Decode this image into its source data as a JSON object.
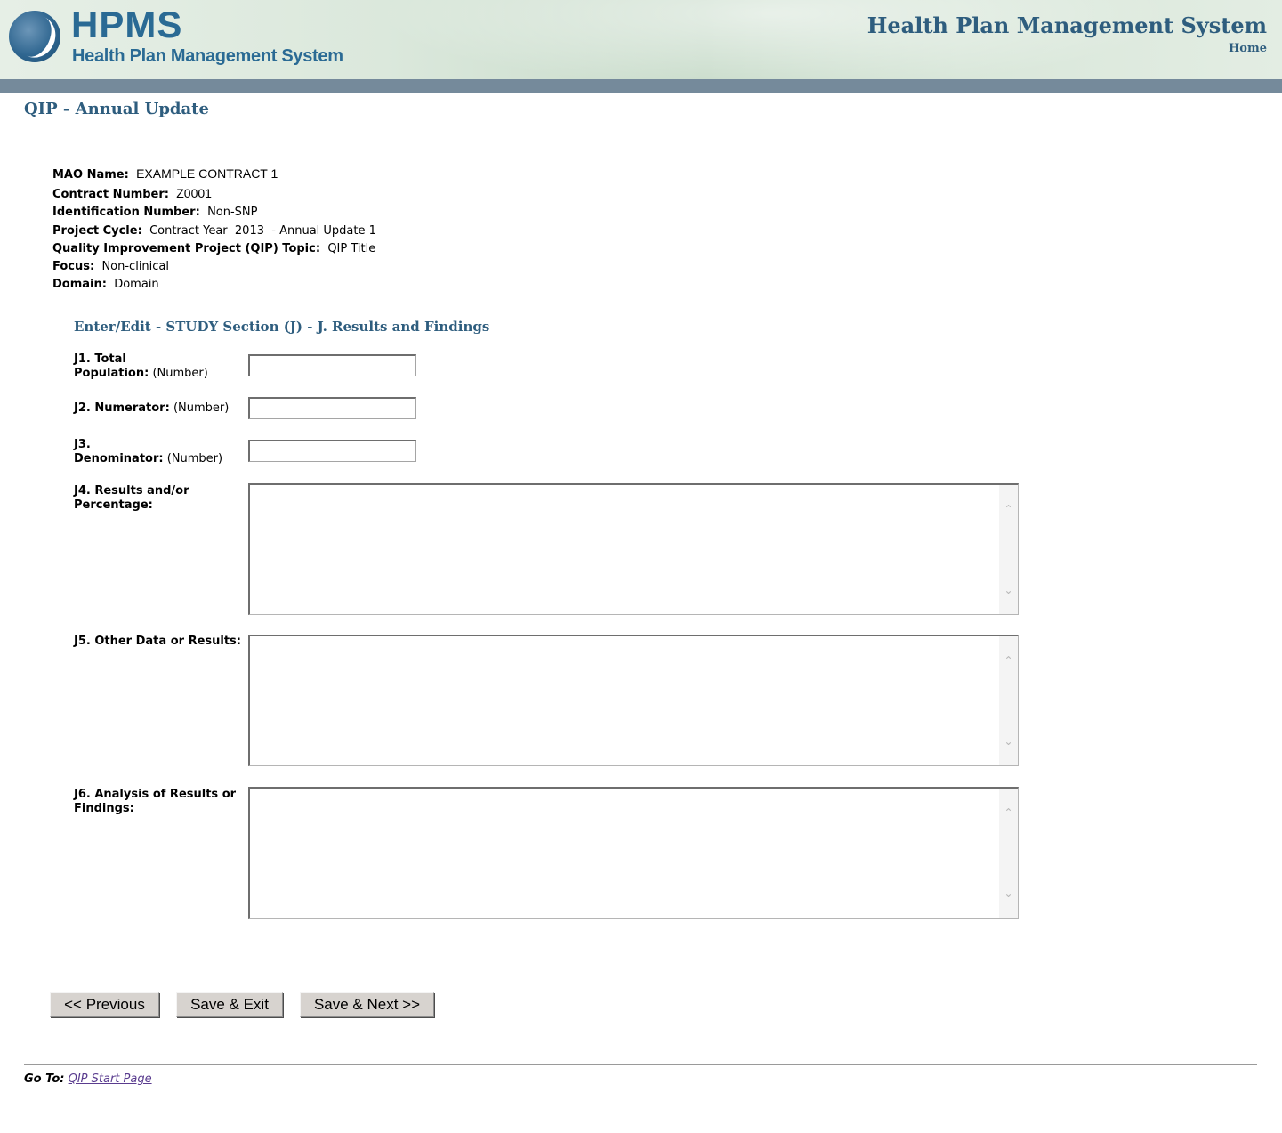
{
  "header": {
    "logo_text": "HPMS",
    "logo_subtitle": "Health Plan Management System",
    "title": "Health Plan Management System",
    "home_link": "Home"
  },
  "page_title": "QIP - Annual Update",
  "info": {
    "mao_name_label": "MAO Name:",
    "mao_name_value": "EXAMPLE CONTRACT 1",
    "contract_number_label": "Contract Number:",
    "contract_number_value": "Z0001",
    "identification_number_label": "Identification Number:",
    "identification_number_value": "Non-SNP",
    "project_cycle_label": "Project Cycle:",
    "project_cycle_value": "Contract Year  2013  - Annual Update 1",
    "qip_topic_label": "Quality Improvement Project (QIP) Topic:",
    "qip_topic_value": "QIP Title",
    "focus_label": "Focus:",
    "focus_value": "Non-clinical",
    "domain_label": "Domain:",
    "domain_value": "Domain"
  },
  "section_title": "Enter/Edit - STUDY Section (J) - J. Results and Findings",
  "fields": {
    "j1": {
      "label_line1": "J1. Total",
      "label_line2": "Population:",
      "hint": "(Number)",
      "value": ""
    },
    "j2": {
      "label": "J2. Numerator:",
      "hint": "(Number)",
      "value": ""
    },
    "j3": {
      "label_line1": "J3.",
      "label_line2": "Denominator:",
      "hint": "(Number)",
      "value": ""
    },
    "j4": {
      "label_line1": "J4. Results and/or",
      "label_line2": "Percentage:",
      "value": ""
    },
    "j5": {
      "label": "J5. Other Data or Results:",
      "value": ""
    },
    "j6": {
      "label_line1": "J6. Analysis of Results or",
      "label_line2": "Findings:",
      "value": ""
    }
  },
  "buttons": {
    "previous": "<< Previous",
    "save_exit": "Save & Exit",
    "save_next": "Save & Next >>"
  },
  "footer": {
    "goto_label": "Go To:",
    "link_text": "QIP Start Page"
  },
  "colors": {
    "heading": "#2e5d7e",
    "header_bar": "#758a9b",
    "button_face": "#d7d3cf",
    "link": "#5a3c8f"
  },
  "icons": {
    "scroll_up": "chevron-up-icon",
    "scroll_down": "chevron-down-icon"
  }
}
